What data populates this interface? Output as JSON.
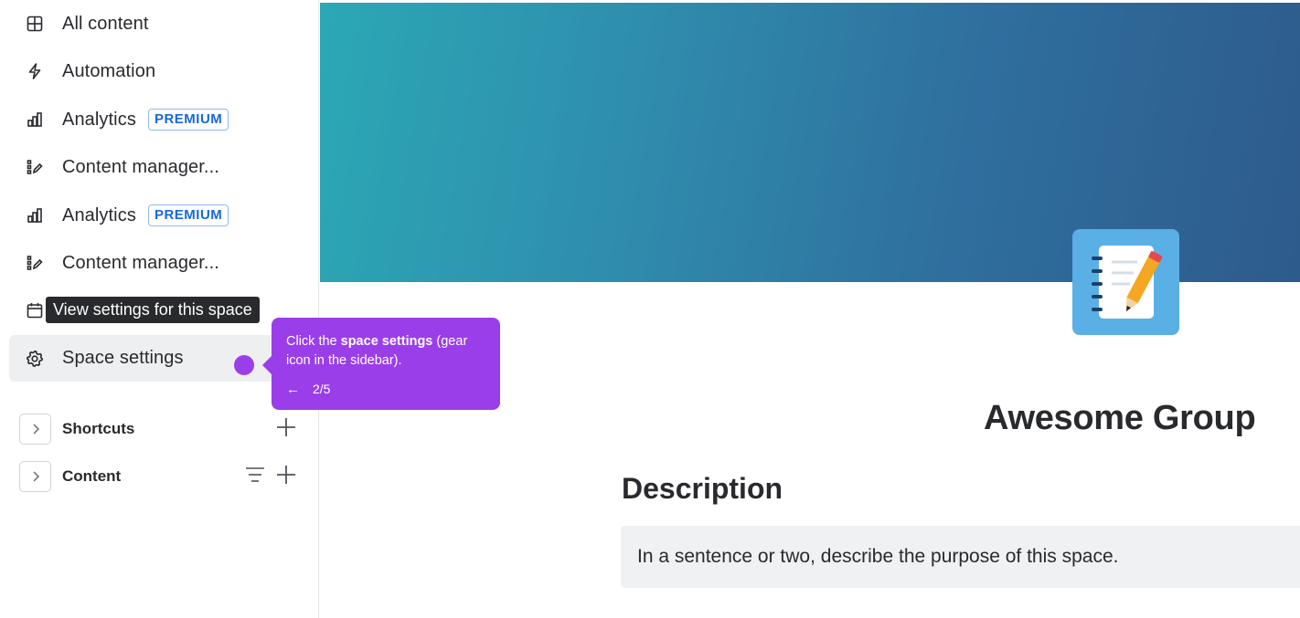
{
  "sidebar": {
    "items": [
      {
        "label": "All content",
        "icon": "grid-icon"
      },
      {
        "label": "Automation",
        "icon": "lightning-icon"
      },
      {
        "label": "Analytics",
        "icon": "analytics-icon",
        "badge": "PREMIUM"
      },
      {
        "label": "Content manager...",
        "icon": "content-manager-icon"
      },
      {
        "label": "Analytics",
        "icon": "analytics-icon",
        "badge": "PREMIUM"
      },
      {
        "label": "Content manager...",
        "icon": "content-manager-icon"
      },
      {
        "label": "Calendar",
        "icon": "calendar-icon"
      },
      {
        "label": "Space settings",
        "icon": "gear-icon",
        "active": true
      }
    ],
    "tooltip": "View settings for this space",
    "sections": [
      {
        "label": "Shortcuts"
      },
      {
        "label": "Content"
      }
    ]
  },
  "guide": {
    "text_prefix": "Click the ",
    "text_bold": "space settings",
    "text_suffix": " (gear icon in the sidebar).",
    "back_arrow": "←",
    "step": "2/5",
    "color": "#9a3eea"
  },
  "main": {
    "space_title": "Awesome Group",
    "description_heading": "Description",
    "description_placeholder": "In a sentence or two, describe the purpose of this space.",
    "space_icon": "notebook-pencil-icon"
  },
  "colors": {
    "accent": "#1868db",
    "banner_start": "#2ba8b5",
    "banner_end": "#2d5b8c"
  }
}
